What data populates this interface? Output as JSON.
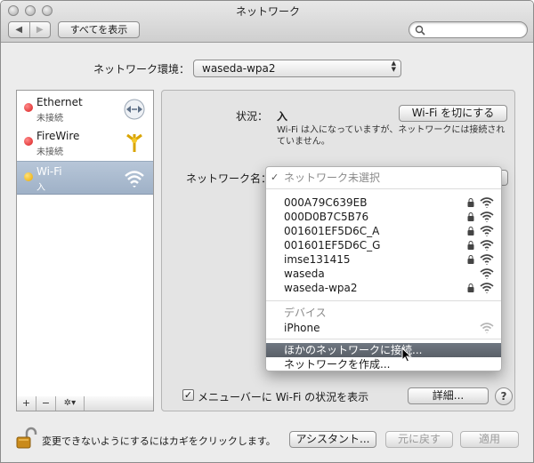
{
  "window": {
    "title": "ネットワーク"
  },
  "toolbar": {
    "back": "◀",
    "forward": "▶",
    "show_all": "すべてを表示",
    "search_placeholder": ""
  },
  "location": {
    "label": "ネットワーク環境：",
    "value": "waseda-wpa2"
  },
  "services": [
    {
      "name": "Ethernet",
      "status": "未接続",
      "dot_color": "#d81d1d",
      "icon": "ethernet-arrows-icon"
    },
    {
      "name": "FireWire",
      "status": "未接続",
      "dot_color": "#d81d1d",
      "icon": "firewire-icon"
    },
    {
      "name": "Wi-Fi",
      "status": "入",
      "dot_color": "#e8a800",
      "icon": "wifi-icon",
      "selected": true
    }
  ],
  "sidebar_buttons": {
    "add": "+",
    "remove": "−",
    "gear": "✲▾"
  },
  "status": {
    "label": "状況：",
    "value": "入",
    "toggle_button": "Wi-Fi を切にする",
    "description": "Wi-Fi は入になっていますが、ネットワークには接続されていません。"
  },
  "network_name": {
    "label": "ネットワーク名：",
    "selected": "ネットワーク未選択",
    "networks": [
      {
        "name": "000A79C639EB",
        "locked": true
      },
      {
        "name": "000D0B7C5B76",
        "locked": true
      },
      {
        "name": "001601EF5D6C_A",
        "locked": true
      },
      {
        "name": "001601EF5D6C_G",
        "locked": true
      },
      {
        "name": "imse131415",
        "locked": true
      },
      {
        "name": "waseda",
        "locked": false
      },
      {
        "name": "waseda-wpa2",
        "locked": true
      }
    ],
    "devices_header": "デバイス",
    "devices": [
      {
        "name": "iPhone"
      }
    ],
    "join_other": "ほかのネットワークに接続...",
    "create_network": "ネットワークを作成..."
  },
  "menubar_option": {
    "label": "メニューバーに Wi-Fi の状況を表示",
    "checked": true,
    "check_glyph": "✓"
  },
  "buttons": {
    "advanced": "詳細...",
    "help": "?",
    "assistant": "アシスタント...",
    "revert": "元に戻す",
    "apply": "適用"
  },
  "footer": {
    "lock_text": "変更できないようにするにはカギをクリックします。"
  },
  "colors": {
    "selection": "#a9bbd0",
    "highlight": "#5f666e",
    "accent_blue": "#2f8fe0"
  }
}
